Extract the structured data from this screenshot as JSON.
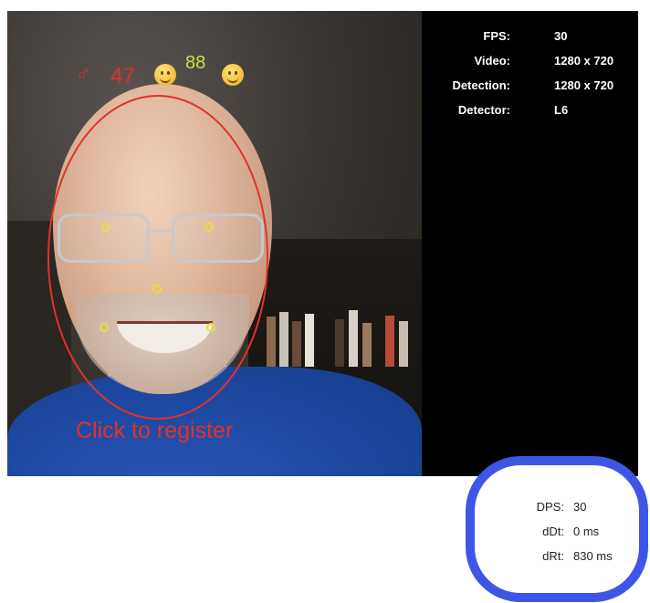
{
  "overlay": {
    "gender_symbol": "♂",
    "age": "47",
    "score": "88",
    "action_text": "Click to register",
    "colors": {
      "overlay_red": "#e0332a",
      "landmark_yellow": "#e8e03a"
    },
    "icons": [
      "male-symbol-icon",
      "smiling-face-emoji-icon",
      "grinning-face-emoji-icon"
    ]
  },
  "stats": [
    {
      "label": "FPS:",
      "value": "30"
    },
    {
      "label": "Video:",
      "value": "1280 x 720"
    },
    {
      "label": "Detection:",
      "value": "1280 x 720"
    },
    {
      "label": "Detector:",
      "value": "L6"
    }
  ],
  "performance": [
    {
      "label": "DPS:",
      "value": "30"
    },
    {
      "label": "dDt:",
      "value": "0 ms"
    },
    {
      "label": "dRt:",
      "value": "830 ms"
    }
  ],
  "highlight_color": "#3e56e6"
}
